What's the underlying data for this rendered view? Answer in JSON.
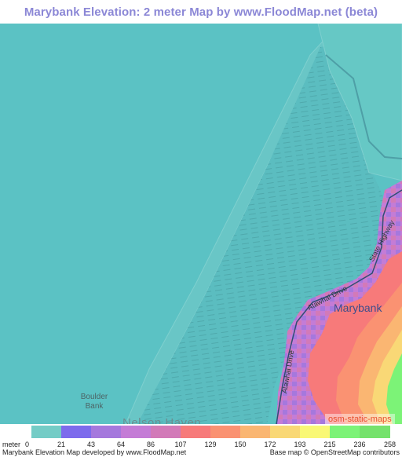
{
  "title": "Marybank Elevation: 2 meter Map by www.FloodMap.net (beta)",
  "map": {
    "place_label": "Marybank",
    "bank_label": "Boulder Bank",
    "water_label": "Nelson Haven",
    "roads": [
      {
        "name": "State Highway"
      },
      {
        "name": "Atawhai Drive"
      },
      {
        "name": "Atawhai Drive"
      }
    ],
    "attribution_badge": "osm-static-maps",
    "water_color": "#5BC2C4"
  },
  "legend": {
    "unit": "meter",
    "ticks": [
      "0",
      "21",
      "43",
      "64",
      "86",
      "107",
      "129",
      "150",
      "172",
      "193",
      "215",
      "236",
      "258"
    ],
    "colors": [
      "#74CCC6",
      "#7D6BEC",
      "#A578DD",
      "#C47CD6",
      "#D27AB8",
      "#F77A7A",
      "#FA9272",
      "#FAB672",
      "#F9D876",
      "#F9F876",
      "#7CF377",
      "#75E26C"
    ]
  },
  "footer": {
    "left": "Marybank Elevation Map developed by www.FloodMap.net",
    "right": "Base map © OpenStreetMap contributors"
  }
}
